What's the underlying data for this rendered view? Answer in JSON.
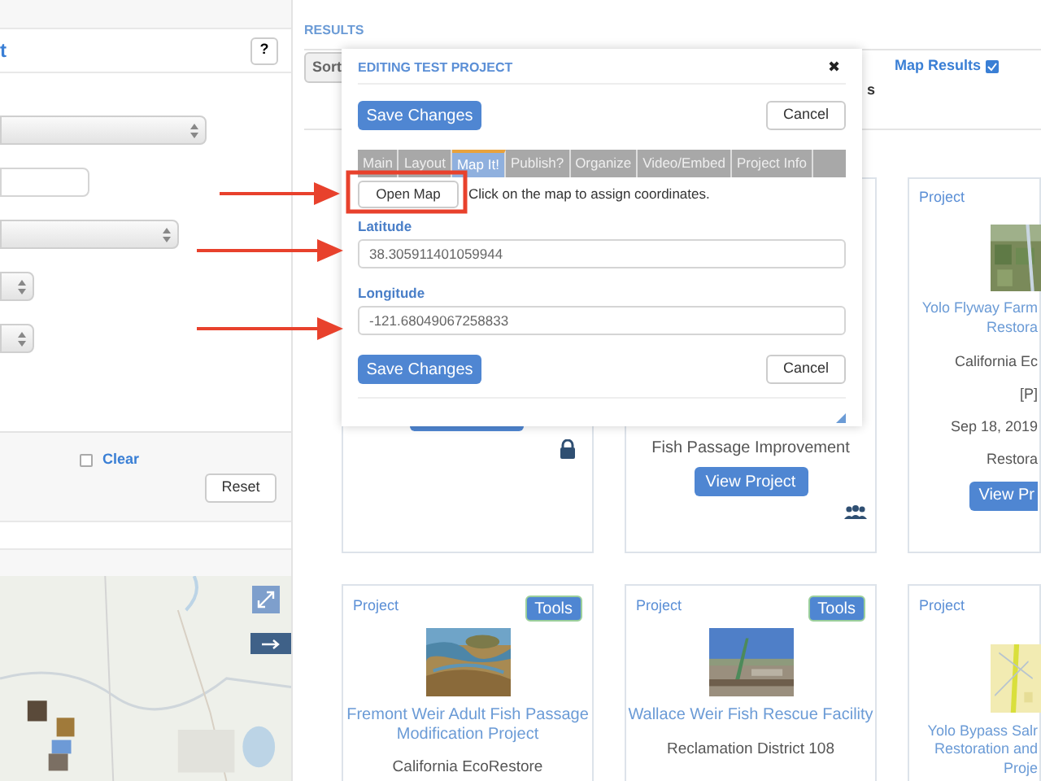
{
  "filters": {
    "title": "t",
    "help_button": "?",
    "clear": {
      "label": "Clear",
      "checked": false
    },
    "reset_button": "Reset"
  },
  "results": {
    "heading": "RESULTS",
    "sort_button": "Sort",
    "map_results": {
      "label": "Map Results",
      "checked": true
    },
    "tab_fragment": "s"
  },
  "cards_top": [
    {
      "kind": "locked"
    },
    {
      "kind": "team",
      "category": "Fish Passage Improvement",
      "view_button": "View Project"
    },
    {
      "kind": "detail",
      "label": "Project",
      "title_lines": [
        "Yolo Flyway Farm",
        "Restora"
      ],
      "details": [
        "California Ec",
        "[P]",
        "Sep 18, 2019",
        "Restora"
      ],
      "view_button": "View Pr"
    }
  ],
  "cards_bottom": [
    {
      "label": "Project",
      "tools_button": "Tools",
      "title_lines": [
        "Fremont Weir Adult Fish Passage",
        "Modification Project"
      ],
      "details": [
        "California EcoRestore"
      ]
    },
    {
      "label": "Project",
      "tools_button": "Tools",
      "title_lines": [
        "Wallace Weir Fish Rescue Facility"
      ],
      "details": [
        "Reclamation District 108"
      ]
    },
    {
      "label": "Project",
      "title_lines": [
        "Yolo Bypass Salr",
        "Restoration and",
        "Proje"
      ]
    }
  ],
  "modal": {
    "title": "EDITING TEST PROJECT",
    "close": "✖",
    "save_button": "Save Changes",
    "cancel_button": "Cancel",
    "tabs": [
      {
        "label": "Main",
        "selected": false
      },
      {
        "label": "Layout",
        "selected": false
      },
      {
        "label": "Map It!",
        "selected": true
      },
      {
        "label": "Publish?",
        "selected": false
      },
      {
        "label": "Organize",
        "selected": false
      },
      {
        "label": "Video/Embed",
        "selected": false
      },
      {
        "label": "Project Info",
        "selected": false
      }
    ],
    "open_map_button": "Open Map",
    "hint": "Click on the map to assign coordinates.",
    "fields": [
      {
        "label": "Latitude",
        "value": "38.305911401059944"
      },
      {
        "label": "Longitude",
        "value": "-121.68049067258833"
      }
    ],
    "footer_save_button": "Save Changes",
    "footer_cancel_button": "Cancel"
  }
}
